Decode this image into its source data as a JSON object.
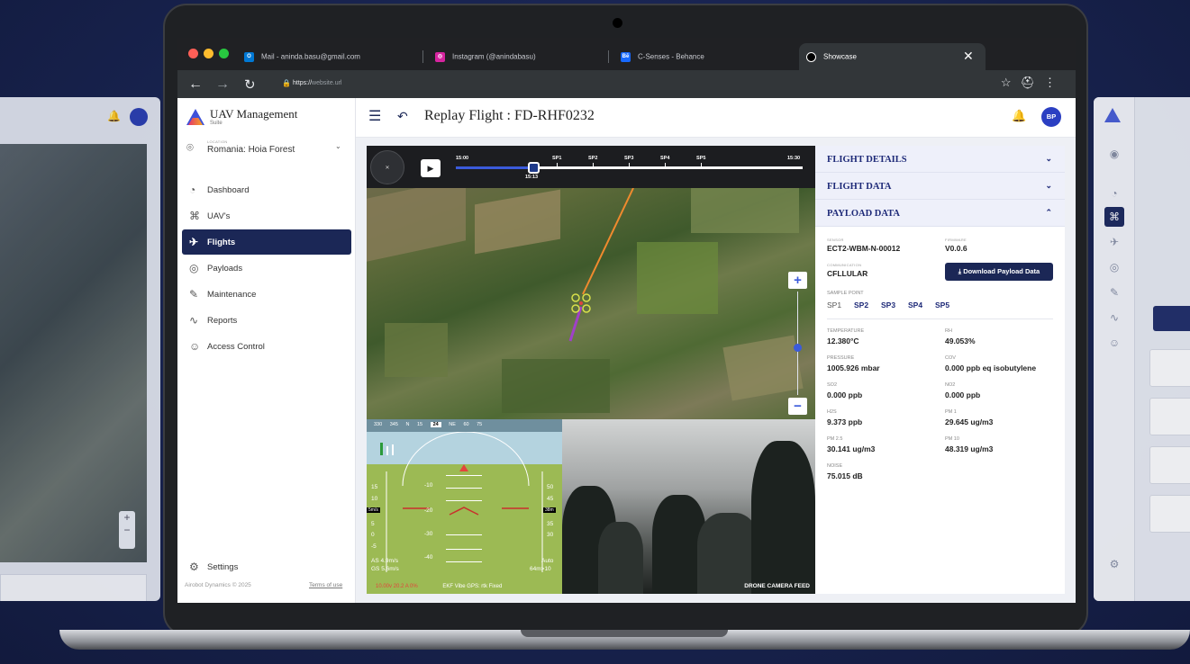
{
  "browser": {
    "tabs": [
      {
        "label": "Mail - aninda.basu@gmail.com",
        "icon": "O",
        "color": "#0078d4"
      },
      {
        "label": "Instagram (@anindabasu)",
        "icon": "◎",
        "color": "#d6249f"
      },
      {
        "label": "C-Senses - Behance",
        "icon": "Bē",
        "color": "#1769ff"
      },
      {
        "label": "Showcase",
        "icon": "●",
        "color": "#ffffff"
      }
    ],
    "close": "✕",
    "url_scheme": "https://",
    "url_host": "website.url"
  },
  "app": {
    "brand": "UAV Management",
    "brand_sub": "Suite",
    "location_label": "LOCATION",
    "location_value": "Romania: Hoia Forest",
    "menu": [
      "Dashboard",
      "UAV's",
      "Flights",
      "Payloads",
      "Maintenance",
      "Reports",
      "Access Control"
    ],
    "settings": "Settings",
    "footer": "Airobot Dynamics © 2025",
    "terms": "Terms of use",
    "page_title": "Replay Flight : FD-RHF0232",
    "avatar": "BP"
  },
  "player": {
    "start": "15:00",
    "end": "15:30",
    "current": "15:13",
    "progress_fraction": 0.226,
    "points": [
      "SP1",
      "SP2",
      "SP3",
      "SP4",
      "SP5"
    ]
  },
  "hud": {
    "heading": [
      "330",
      "345",
      "N",
      "15",
      "24",
      "NE",
      "60",
      "75"
    ],
    "heading_current": "24",
    "pitch": [
      "-10",
      "-20",
      "-30",
      "-40"
    ],
    "left_scale": [
      "15",
      "10",
      "5",
      "0",
      "-5"
    ],
    "right_scale": [
      "50",
      "45",
      "35",
      "30"
    ],
    "left_tag": "5m/s",
    "right_tag": "38m",
    "as": "AS 4.9m/s",
    "gs": "GS 5.6m/s",
    "mode": "Auto",
    "mode_sub": "64m>10",
    "battery": "10.00v  20.2 A  0%",
    "status": "EKF  Vibe  GPS: rtk Fixed"
  },
  "camera_label": "DRONE CAMERA FEED",
  "panel": {
    "flight_details": "FLIGHT DETAILS",
    "flight_data": "FLIGHT DATA",
    "payload_data": "PAYLOAD DATA",
    "sensor_label": "SENSOR",
    "sensor": "ECT2-WBM-N-00012",
    "firmware_label": "FIRMWARE",
    "firmware": "V0.0.6",
    "comm_label": "COMMUNICATION",
    "comm": "CFLLULAR",
    "download": "Download Payload Data",
    "sample_label": "SAMPLE POINT",
    "samples": [
      "SP1",
      "SP2",
      "SP3",
      "SP4",
      "SP5"
    ],
    "readings": [
      {
        "label": "TEMPERATURE",
        "value": "12.380°C"
      },
      {
        "label": "RH",
        "value": "49.053%"
      },
      {
        "label": "PRESSURE",
        "value": "1005.926 mbar"
      },
      {
        "label": "COV",
        "value": "0.000 ppb eq isobutylene"
      },
      {
        "label": "SO2",
        "value": "0.000 ppb"
      },
      {
        "label": "NO2",
        "value": "0.000 ppb"
      },
      {
        "label": "H2S",
        "value": "9.373 ppb"
      },
      {
        "label": "PM 1",
        "value": "29.645 ug/m3"
      },
      {
        "label": "PM 2.5",
        "value": "30.141 ug/m3"
      },
      {
        "label": "PM 10",
        "value": "48.319 ug/m3"
      },
      {
        "label": "NOISE",
        "value": "75.015 dB"
      }
    ]
  }
}
